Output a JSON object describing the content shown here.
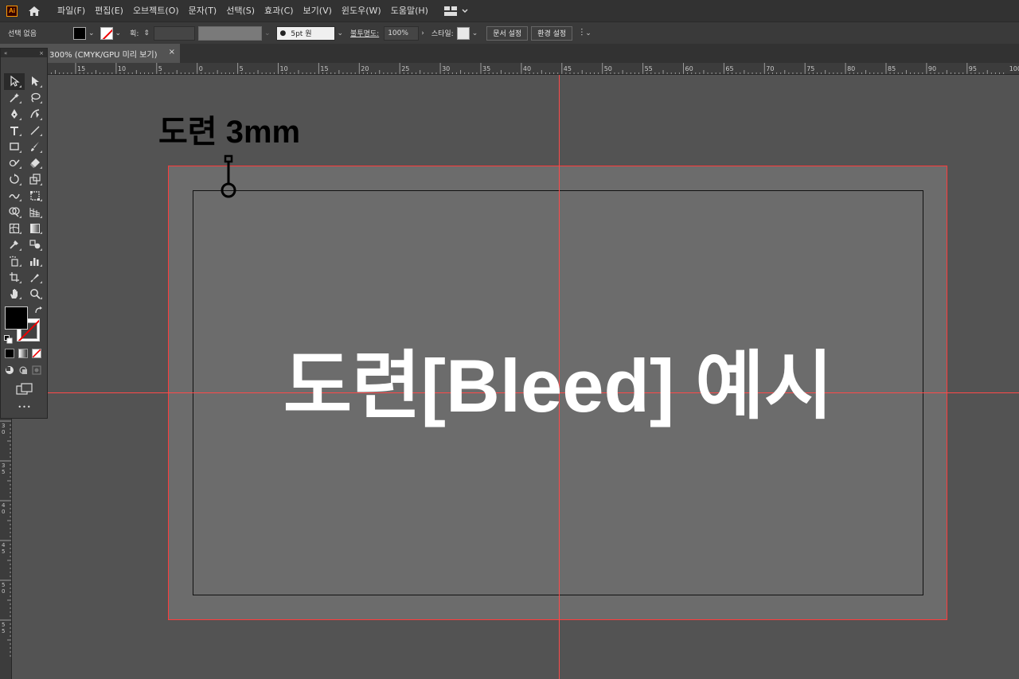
{
  "menubar": {
    "logo": "Ai",
    "items": [
      "파일(F)",
      "편집(E)",
      "오브젝트(O)",
      "문자(T)",
      "선택(S)",
      "효과(C)",
      "보기(V)",
      "윈도우(W)",
      "도움말(H)"
    ]
  },
  "controlbar": {
    "selection_label": "선택 없음",
    "stroke_label": "획:",
    "brush_value": "5pt 원",
    "opacity_label": "불투명도:",
    "opacity_value": "100%",
    "style_label": "스타일:",
    "doc_setup_button": "문서 설정",
    "prefs_button": "환경 설정"
  },
  "tab": {
    "title": "300% (CMYK/GPU 미리 보기)",
    "close": "×"
  },
  "ruler": {
    "top_labels": [
      "15",
      "10",
      "5",
      "0",
      "5",
      "10",
      "15",
      "20",
      "25",
      "30",
      "35",
      "40",
      "45",
      "50",
      "55",
      "60",
      "65",
      "70",
      "75",
      "80",
      "85",
      "90",
      "95",
      "100"
    ],
    "left_labels": [
      "3 0",
      "3 5",
      "4 0",
      "4 5",
      "5 0",
      "5 5"
    ]
  },
  "toolpanel": {
    "collapse": "«",
    "close": "×",
    "more": "•••"
  },
  "artboard": {
    "bleed_label": "도련 3mm",
    "title": "도련[Bleed] 예시"
  },
  "colors": {
    "bleed_guide": "#ff3b3b",
    "artboard": "#6c6c6c",
    "pasteboard": "#535353",
    "ai_logo": "#ff9a00"
  }
}
